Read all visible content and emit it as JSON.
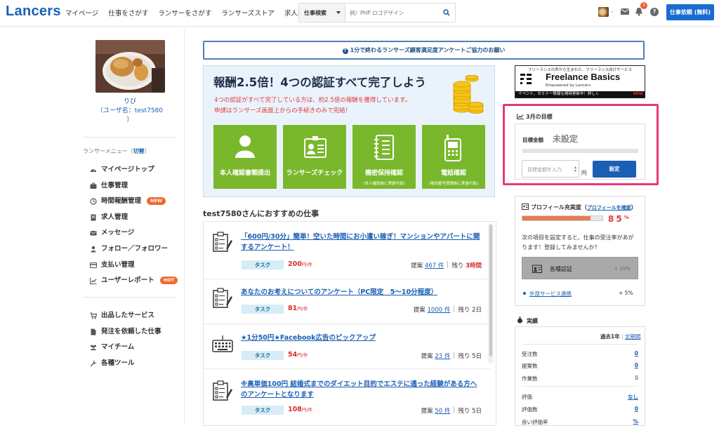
{
  "header": {
    "logo": "Lancers",
    "nav": [
      "マイページ",
      "仕事をさがす",
      "ランサーをさがす",
      "ランサーズストア",
      "求人募集"
    ],
    "search_select": "仕事検索",
    "search_placeholder": "例）PHP ロゴデザイン",
    "user_dash": "-",
    "notification_count": "3",
    "help": "?",
    "order_button": "仕事依頼 (無料)"
  },
  "sidebar": {
    "user_name": "りび",
    "user_id_line": "（ユーザ名：test7580",
    "user_id_close": "）",
    "menu_title": "ランサーメニュー（",
    "menu_toggle": "切替",
    "menu_title_close": "）",
    "menu": [
      {
        "label": "マイページトップ",
        "icon": "dashboard-icon"
      },
      {
        "label": "仕事管理",
        "icon": "briefcase-icon"
      },
      {
        "label": "時間報酬管理",
        "icon": "clock-icon",
        "badge": "NEW"
      },
      {
        "label": "求人管理",
        "icon": "document-icon"
      },
      {
        "label": "メッセージ",
        "icon": "envelope-icon"
      },
      {
        "label": "フォロー／フォロワー",
        "icon": "person-icon"
      },
      {
        "label": "支払い管理",
        "icon": "credit-card-icon"
      },
      {
        "label": "ユーザーレポート",
        "icon": "line-chart-icon",
        "badge": "HOT"
      }
    ],
    "menu2": [
      {
        "label": "出品したサービス",
        "icon": "cart-icon"
      },
      {
        "label": "発注を依頼した仕事",
        "icon": "file-icon"
      },
      {
        "label": "マイチーム",
        "icon": "team-icon"
      },
      {
        "label": "各種ツール",
        "icon": "wrench-icon"
      }
    ]
  },
  "notice": "1分で終わるランサーズ顧客満足度アンケートご協力のお願い",
  "promo": {
    "title": "報酬2.5倍！4つの認証すべて完了しよう",
    "line1": "4つの認証がすべて完了している方は、約2.5倍の報酬を獲得しています。",
    "line2": "申請はランサーズ画面上からの手続きのみで完結！",
    "tiles": [
      {
        "label": "本人確認書類提出",
        "note": ""
      },
      {
        "label": "ランサーズチェック",
        "note": ""
      },
      {
        "label": "機密保持確認",
        "note": "(本人確認後に実施可能)"
      },
      {
        "label": "電話確認",
        "note": "(電話番号登録後に実施可能)"
      }
    ]
  },
  "recommend_heading": "test7580さんにおすすめの仕事",
  "jobs": [
    {
      "title": "「600円/30分」簡単！空いた時間にお小遣い稼ぎ！マンションやアパートに関するアンケート！",
      "tag": "タスク",
      "price": "200",
      "unit": "円/件",
      "proposals_label": "提案",
      "proposals": "467 件",
      "remain_label": "残り",
      "remain": "3時間",
      "remain_red": true,
      "icon": "survey-icon"
    },
    {
      "title": "あなたのお考えについてのアンケート（PC限定　5〜10分程度）",
      "tag": "タスク",
      "price": "81",
      "unit": "円/件",
      "proposals_label": "提案",
      "proposals": "1000 件",
      "remain_label": "残り",
      "remain": "2日",
      "remain_red": false,
      "icon": "survey-icon"
    },
    {
      "title": "★1分50円★Facebook広告のピックアップ",
      "tag": "タスク",
      "price": "54",
      "unit": "円/件",
      "proposals_label": "提案",
      "proposals": "23 件",
      "remain_label": "残り",
      "remain": "5日",
      "remain_red": false,
      "icon": "keyboard-icon"
    },
    {
      "title": "※高単価100円 結婚式までのダイエット目的でエステに通った経験がある方へのアンケートとなります",
      "tag": "タスク",
      "price": "108",
      "unit": "円/件",
      "proposals_label": "提案",
      "proposals": "50 件",
      "remain_label": "残り",
      "remain": "5日",
      "remain_red": false,
      "icon": "survey-icon"
    }
  ],
  "banner": {
    "top_text": "フリーランスの声から生まれた、フリーランス向けサービス",
    "name": "Freelance Basics",
    "by": "Empowered by Lancers",
    "strip": "イベント、セミナー情報も随時更新中！詳しく",
    "new": "NEW"
  },
  "goal": {
    "heading": "3月の目標",
    "label": "目標金額",
    "value": "未設定",
    "input_placeholder": "目標金額を入力",
    "unit": "円",
    "button": "設定"
  },
  "profile": {
    "heading": "プロフィール充実度（",
    "link": "プロフィールを確認",
    "heading_close": "）",
    "percent": "85",
    "percent_unit": "%",
    "fill": 0.85,
    "text": "次の項目を設定すると、仕事の受注率があがります！登録してみませんか？",
    "card_label": "各種認証",
    "card_value": "+ 10%",
    "link_item": "外部サービス連携",
    "link_item_value": "+ 5%"
  },
  "stats": {
    "heading": "実績",
    "period": "過去1年",
    "period_sep": " | ",
    "period_link": "全期間",
    "rows": [
      {
        "label": "受注数",
        "value": "0",
        "link": true
      },
      {
        "label": "提案数",
        "value": "0",
        "link": true
      },
      {
        "label": "作業数",
        "value": "0",
        "link": false
      },
      {
        "label": "評価",
        "value": "なし",
        "link": true
      },
      {
        "label": "評価数",
        "value": "0",
        "link": true
      },
      {
        "label": "良い評価率",
        "value": "%",
        "link": true
      }
    ]
  },
  "colors": {
    "brand": "#1a5fb4",
    "accent_red": "#e0393e",
    "tile_green": "#79b82c",
    "highlight": "#e8397a"
  }
}
